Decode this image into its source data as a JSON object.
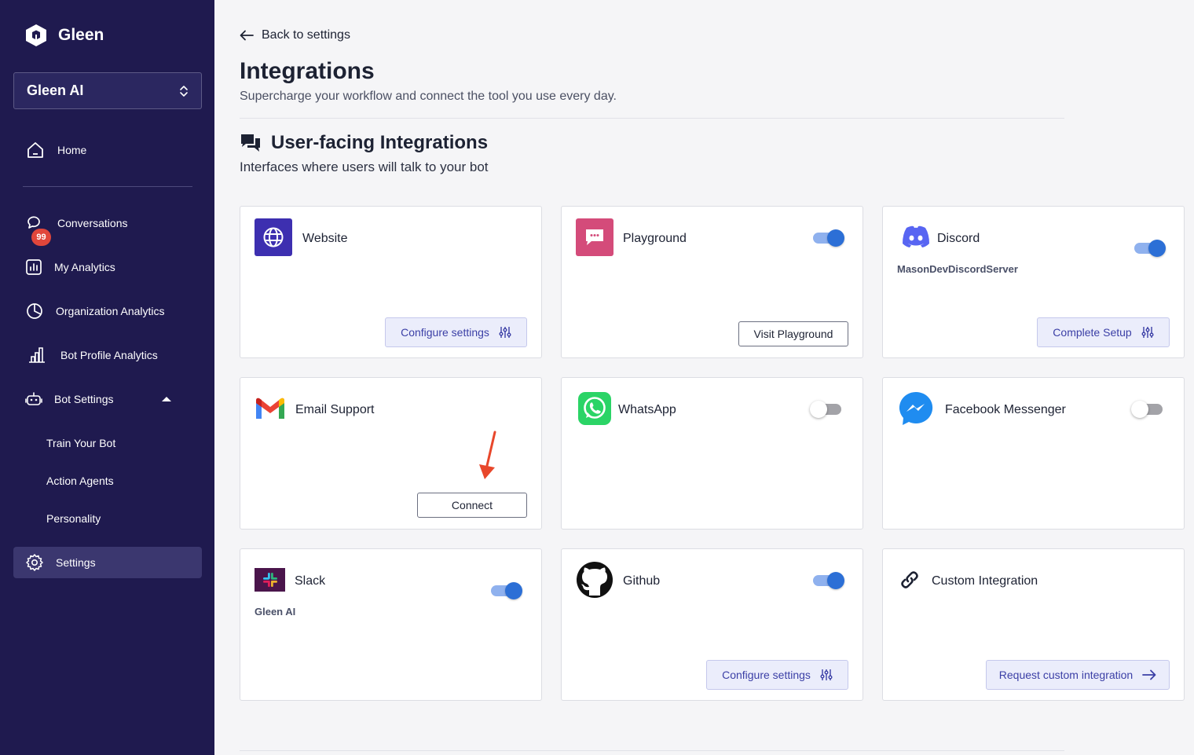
{
  "sidebar": {
    "logo_text": "Gleen",
    "workspace": "Gleen AI",
    "badge_count": "99",
    "items": [
      {
        "label": "Home",
        "icon": "home-icon"
      },
      {
        "label": "Conversations",
        "icon": "chat-icon"
      },
      {
        "label": "My Analytics",
        "icon": "analytics-icon"
      },
      {
        "label": "Organization Analytics",
        "icon": "pie-chart-icon"
      },
      {
        "label": "Bot Profile Analytics",
        "icon": "bar-chart-icon"
      },
      {
        "label": "Bot Settings",
        "icon": "robot-icon"
      },
      {
        "label": "Settings",
        "icon": "gear-icon"
      }
    ],
    "sub_items": [
      "Train Your Bot",
      "Action Agents",
      "Personality"
    ]
  },
  "main": {
    "back_label": "Back to settings",
    "title": "Integrations",
    "subtitle": "Supercharge your workflow and connect the tool you use every day.",
    "section_title": "User-facing Integrations",
    "section_subtitle": "Interfaces where users will talk to your bot"
  },
  "integrations": [
    {
      "name": "Website",
      "icon": "globe-icon",
      "button": "Configure settings"
    },
    {
      "name": "Playground",
      "icon": "message-icon",
      "toggle": "on",
      "button": "Visit Playground"
    },
    {
      "name": "Discord",
      "icon": "discord-icon",
      "toggle": "on",
      "meta": "MasonDevDiscordServer",
      "button": "Complete Setup"
    },
    {
      "name": "Email Support",
      "icon": "gmail-icon",
      "button": "Connect"
    },
    {
      "name": "WhatsApp",
      "icon": "whatsapp-icon",
      "toggle": "off"
    },
    {
      "name": "Facebook Messenger",
      "icon": "messenger-icon",
      "toggle": "off"
    },
    {
      "name": "Slack",
      "icon": "slack-icon",
      "toggle": "on",
      "meta": "Gleen AI"
    },
    {
      "name": "Github",
      "icon": "github-icon",
      "toggle": "on",
      "button": "Configure settings"
    },
    {
      "name": "Custom Integration",
      "icon": "link-icon",
      "button": "Request custom integration"
    }
  ],
  "colors": {
    "sidebar_bg": "#1f1a4f",
    "accent": "#2c6fd6",
    "badge": "#e0463b",
    "annotation_arrow": "#e8472b"
  }
}
